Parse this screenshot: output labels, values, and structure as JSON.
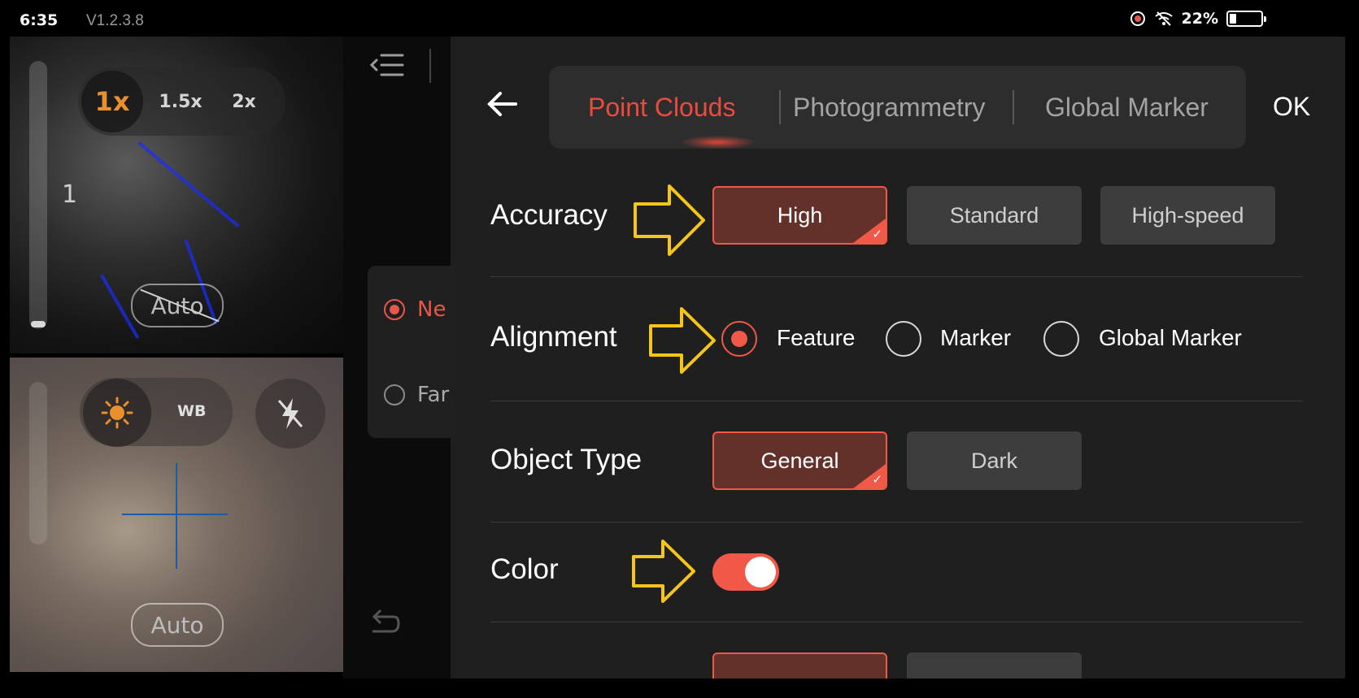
{
  "status_bar": {
    "time": "6:35",
    "version": "V1.2.3.8",
    "battery": "22%",
    "battery_level": 0.22,
    "icons": [
      "record-icon",
      "wifi-off-icon",
      "battery-icon"
    ]
  },
  "camera_top": {
    "zoom_options": [
      "1x",
      "1.5x",
      "2x"
    ],
    "zoom_selected": "1x",
    "level_value": "1",
    "auto_label": "Auto"
  },
  "camera_bottom": {
    "wb_label": "WB",
    "auto_label": "Auto",
    "icons": [
      "brightness-icon",
      "flash-off-icon"
    ]
  },
  "background_menu": {
    "option_near": "Ne",
    "option_far": "Far"
  },
  "panel": {
    "tabs": [
      "Point Clouds",
      "Photogrammetry",
      "Global Marker"
    ],
    "active_tab": "Point Clouds",
    "ok_label": "OK",
    "accuracy": {
      "label": "Accuracy",
      "options": [
        "High",
        "Standard",
        "High-speed"
      ],
      "selected": "High"
    },
    "alignment": {
      "label": "Alignment",
      "options": [
        "Feature",
        "Marker",
        "Global Marker"
      ],
      "selected": "Feature"
    },
    "object_type": {
      "label": "Object Type",
      "options": [
        "General",
        "Dark"
      ],
      "selected": "General"
    },
    "color": {
      "label": "Color",
      "enabled": true
    }
  },
  "colors": {
    "accent": "#f05848",
    "selected_bg": "#63302a",
    "annotation_arrow": "#f5c518"
  }
}
